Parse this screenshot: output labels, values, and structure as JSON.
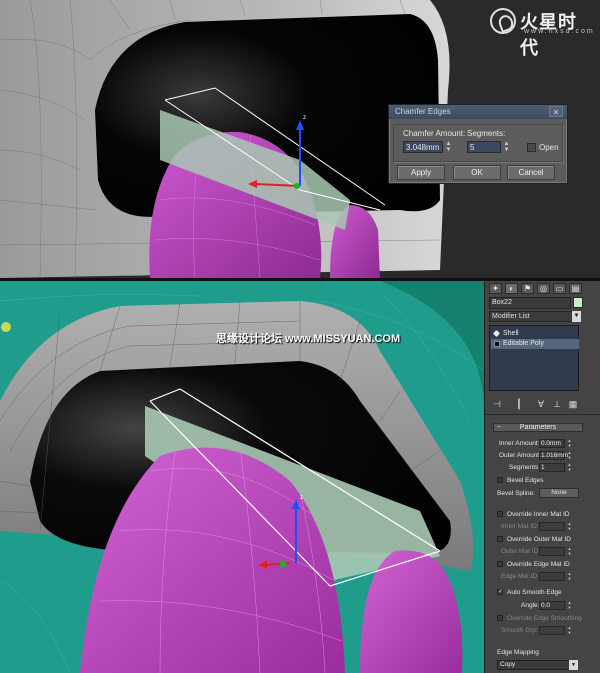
{
  "top_viewport": {
    "logo": {
      "brand": "火星时代",
      "url": "www.hxsd.com"
    },
    "chamfer_dialog": {
      "title": "Chamfer Edges",
      "close_icon": "close-icon",
      "chamfer_amount_label": "Chamfer Amount:",
      "chamfer_amount_value": "3.048mm",
      "segments_label": "Segments:",
      "segments_value": "5",
      "open_label": "Open",
      "open_checked": false,
      "apply_label": "Apply",
      "ok_label": "OK",
      "cancel_label": "Cancel"
    },
    "gizmo_axis_label": "z"
  },
  "bottom_viewport": {
    "watermark": "思缘设计论坛 www.MISSYUAN.COM",
    "gizmo_axis_label": "z"
  },
  "command_panel": {
    "tab_icons": [
      "create-icon",
      "modify-icon",
      "hierarchy-icon",
      "motion-icon",
      "display-icon",
      "utilities-icon"
    ],
    "object_name": "Box22",
    "object_color": "#c5f0c9",
    "modifier_list_label": "Modifier List",
    "stack": [
      {
        "label": "Shell",
        "icon": "bulb-icon",
        "selected": false
      },
      {
        "label": "Editable Poly",
        "icon": "box-icon",
        "selected": true
      }
    ],
    "stack_tools": [
      "pin-stack-icon",
      "show-end-result-icon",
      "make-unique-icon",
      "remove-modifier-icon",
      "configure-sets-icon"
    ],
    "parameters": {
      "title": "Parameters",
      "inner_amount_label": "Inner Amount:",
      "inner_amount_value": "0.0mm",
      "outer_amount_label": "Outer Amount:",
      "outer_amount_value": "1.016mm",
      "segments_label": "Segments:",
      "segments_value": "1",
      "bevel_edges_label": "Bevel Edges",
      "bevel_spline_label": "Bevel Spline:",
      "bevel_spline_value": "None",
      "override_inner_label": "Override Inner Mat ID",
      "inner_mat_id_label": "Inner Mat ID:",
      "override_outer_label": "Override Outer Mat ID",
      "outer_mat_id_label": "Outer Mat ID:",
      "override_edge_label": "Override Edge Mat ID",
      "edge_mat_id_label": "Edge Mat ID:",
      "auto_smooth_label": "Auto Smooth Edge",
      "auto_smooth_checked": true,
      "angle_label": "Angle:",
      "angle_value": "0.0",
      "override_smoothing_label": "Override Edge Smoothing",
      "smooth_grp_label": "Smooth Grp:",
      "edge_mapping_label": "Edge Mapping",
      "edge_mapping_value": "Copy"
    }
  },
  "colors": {
    "magenta": "#b23bb5",
    "teal": "#1f9c8b",
    "shell_grey": "#8c8c8c",
    "selection_white": "#ffffff",
    "panel_bg": "#444444",
    "stack_bg": "#2f3a4c"
  }
}
